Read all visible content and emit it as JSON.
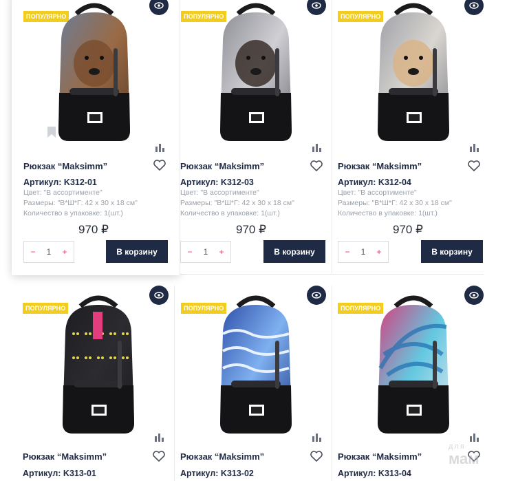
{
  "badge_label": "Популярно",
  "cart_label": "В корзину",
  "qty_minus": "−",
  "qty_plus": "+",
  "colors": {
    "navy": "#1f2a44",
    "badge": "#f3cd1d",
    "qty_sign": "#e8335a"
  },
  "icons": {
    "quick_view": "eye-icon",
    "compare": "bar-chart-icon",
    "favorite": "heart-outline-icon"
  },
  "products": [
    {
      "title": "Рюкзак “Maksimm”",
      "article": "Артикул: K312-01",
      "color": "Цвет: \"В ассортименте\"",
      "size": "Размеры: \"В*Ш*Г: 42 х 30 х 18 см\"",
      "pack": "Количество в упаковке: 1(шт.)",
      "price": "970 ₽",
      "qty": "1",
      "print": "bear"
    },
    {
      "title": "Рюкзак “Maksimm”",
      "article": "Артикул: K312-03",
      "color": "Цвет: \"В ассортименте\"",
      "size": "Размеры: \"В*Ш*Г: 42 х 30 х 18 см\"",
      "pack": "Количество в упаковке: 1(шт.)",
      "price": "970 ₽",
      "qty": "1",
      "print": "dog"
    },
    {
      "title": "Рюкзак “Maksimm”",
      "article": "Артикул: K312-04",
      "color": "Цвет: \"В ассортименте\"",
      "size": "Размеры: \"В*Ш*Г: 42 х 30 х 18 см\"",
      "pack": "Количество в упаковке: 1(шт.)",
      "price": "970 ₽",
      "qty": "1",
      "print": "tiger"
    },
    {
      "title": "Рюкзак “Maksimm”",
      "article": "Артикул: K313-01",
      "print": "cats"
    },
    {
      "title": "Рюкзак “Maksimm”",
      "article": "Артикул: K313-02",
      "print": "waves"
    },
    {
      "title": "Рюкзак “Maksimm”",
      "article": "Артикул: K313-04",
      "print": "feathers"
    }
  ],
  "watermark": {
    "small": "для",
    "big": "мам"
  }
}
